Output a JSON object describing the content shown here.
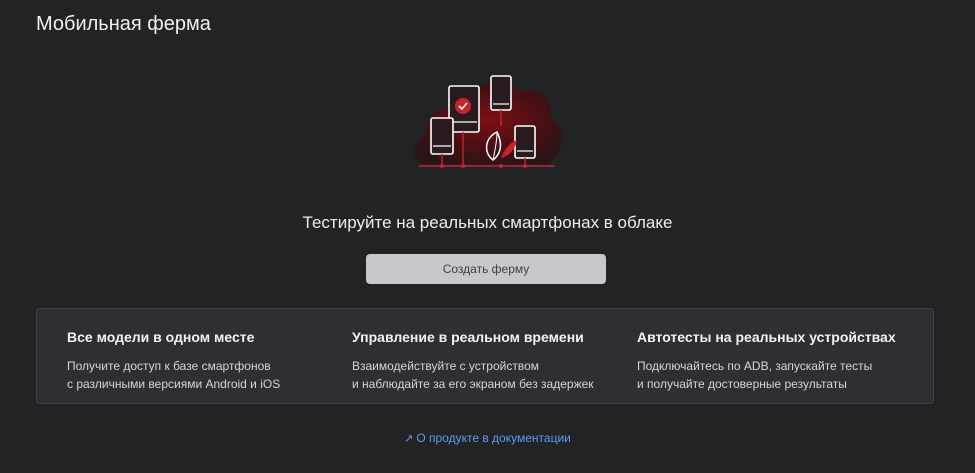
{
  "page": {
    "title": "Мобильная ферма"
  },
  "hero": {
    "illustration_icon": "cloud-devices-illustration",
    "tagline": "Тестируйте на реальных смартфонах в облаке",
    "accent_color": "#c8222c"
  },
  "actions": {
    "create_label": "Создать ферму"
  },
  "features": [
    {
      "title": "Все модели в одном месте",
      "line1": "Получите доступ к базе смартфонов",
      "line2": "с различными версиями Android и iOS"
    },
    {
      "title": "Управление в реальном времени",
      "line1": "Взаимодействуйте с устройством",
      "line2": "и наблюдайте за его экраном без задержек"
    },
    {
      "title": "Автотесты на реальных устройствах",
      "line1": "Подключайтесь по ADB, запускайте тесты",
      "line2": "и получайте достоверные результаты"
    }
  ],
  "docs": {
    "icon": "external-arrow-icon",
    "link_label": "О продукте в документации",
    "link_color": "#5b9cf5"
  }
}
